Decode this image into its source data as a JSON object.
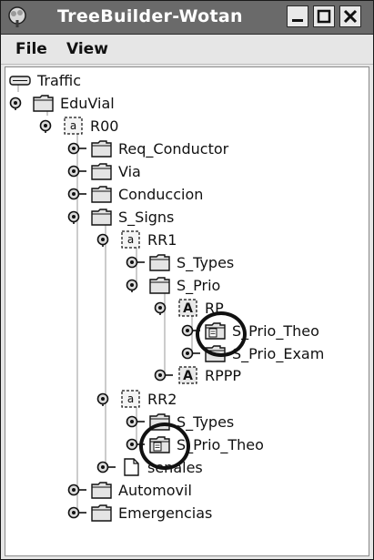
{
  "window": {
    "title": "TreeBuilder-Wotan"
  },
  "menu": {
    "items": [
      "File",
      "View"
    ]
  },
  "tree": {
    "nodes": [
      {
        "label": "Traffic",
        "type": "root"
      },
      {
        "label": "EduVial",
        "type": "folder",
        "handle": "expanded"
      },
      {
        "label": "R00",
        "type": "small-a",
        "handle": "expanded"
      },
      {
        "label": "Req_Conductor",
        "type": "folder",
        "handle": "collapsed"
      },
      {
        "label": "Via",
        "type": "folder",
        "handle": "collapsed"
      },
      {
        "label": "Conduccion",
        "type": "folder",
        "handle": "collapsed"
      },
      {
        "label": "S_Signs",
        "type": "folder",
        "handle": "expanded"
      },
      {
        "label": "RR1",
        "type": "small-a",
        "handle": "expanded"
      },
      {
        "label": "S_Types",
        "type": "folder",
        "handle": "collapsed"
      },
      {
        "label": "S_Prio",
        "type": "folder",
        "handle": "expanded"
      },
      {
        "label": "RP",
        "type": "big-a",
        "handle": "expanded"
      },
      {
        "label": "S_Prio_Theo",
        "type": "folder-doc",
        "handle": "collapsed",
        "highlighted": true
      },
      {
        "label": "S_Prio_Exam",
        "type": "folder",
        "handle": "collapsed"
      },
      {
        "label": "RPPP",
        "type": "big-a",
        "handle": "collapsed"
      },
      {
        "label": "RR2",
        "type": "small-a",
        "handle": "expanded"
      },
      {
        "label": "S_Types",
        "type": "folder",
        "handle": "collapsed"
      },
      {
        "label": "S_Prio_Theo",
        "type": "folder-doc",
        "handle": "collapsed",
        "highlighted": true
      },
      {
        "label": "senales",
        "type": "doc",
        "handle": "collapsed"
      },
      {
        "label": "Automovil",
        "type": "folder",
        "handle": "collapsed"
      },
      {
        "label": "Emergencias",
        "type": "folder",
        "handle": "collapsed"
      }
    ]
  }
}
